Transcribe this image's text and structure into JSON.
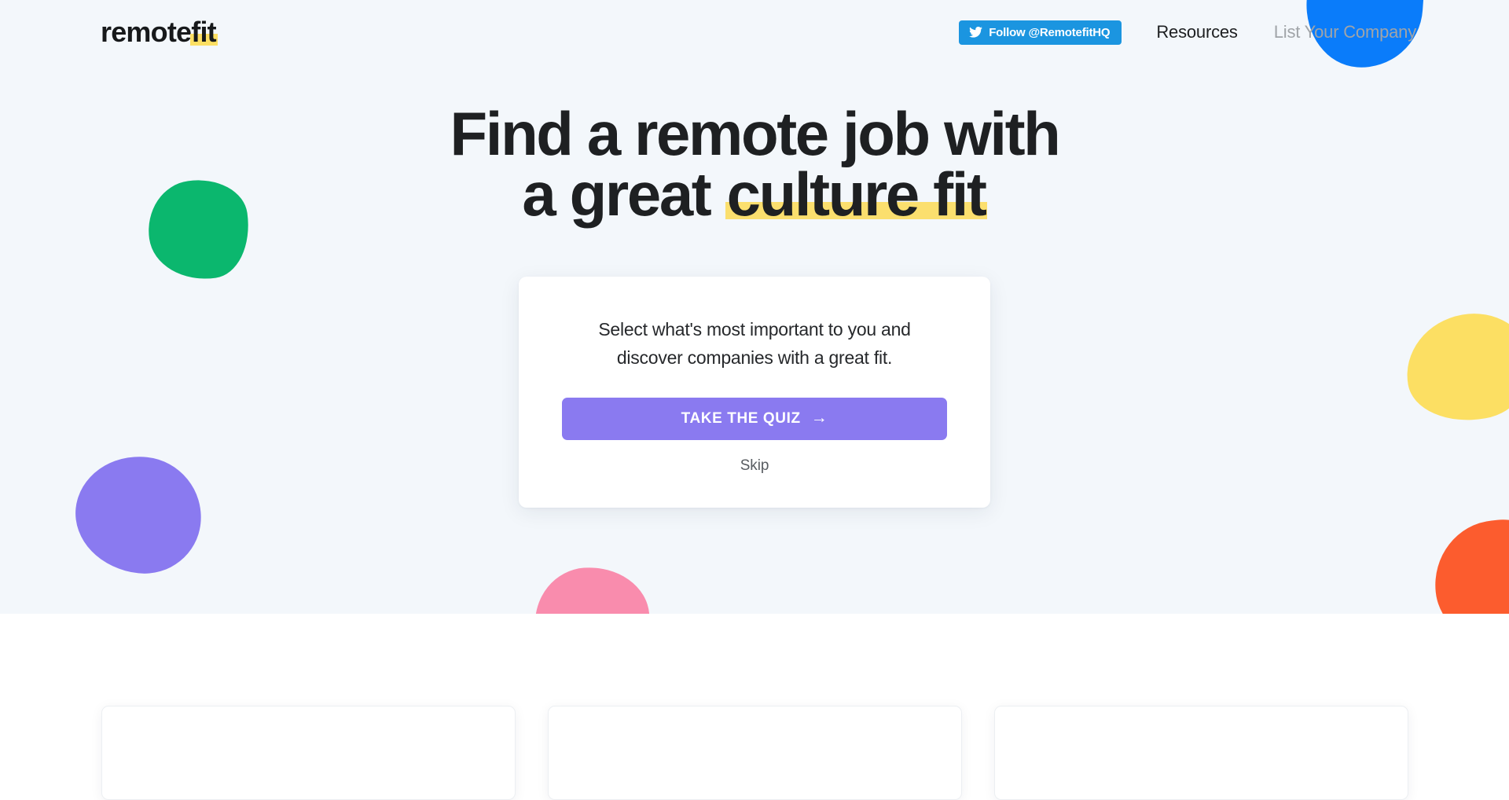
{
  "header": {
    "logo": {
      "text_main": "remote",
      "text_highlight": "fit"
    },
    "twitter_button": {
      "label": "Follow @RemotefitHQ",
      "icon": "twitter-bird-icon",
      "color": "#1b95e0"
    },
    "nav_links": [
      {
        "label": "Resources",
        "style": "dark"
      },
      {
        "label": "List Your Company",
        "style": "muted"
      }
    ]
  },
  "hero": {
    "background_color": "#f3f7fb",
    "headline": {
      "line1": "Find a remote job with",
      "line2_prefix": "a great ",
      "line2_highlight": "culture fit",
      "highlight_color": "#fbdf6e"
    },
    "card": {
      "description_line1": "Select what's most important to you and",
      "description_line2": "discover companies with a great fit.",
      "primary_button": {
        "label": "TAKE THE QUIZ",
        "arrow": "→",
        "color": "#8a7af0"
      },
      "secondary_link": {
        "label": "Skip"
      }
    },
    "blobs": [
      {
        "name": "green-blob",
        "color": "#0bb76e"
      },
      {
        "name": "purple-blob",
        "color": "#8a7af0"
      },
      {
        "name": "blue-blob",
        "color": "#0a7cfa"
      },
      {
        "name": "yellow-blob",
        "color": "#fcdf63"
      },
      {
        "name": "orange-blob",
        "color": "#fc5c2e"
      },
      {
        "name": "pink-blob",
        "color": "#f98cad"
      }
    ]
  },
  "below_section": {
    "cards": [
      {
        "name": "feature-card-1"
      },
      {
        "name": "feature-card-2"
      },
      {
        "name": "feature-card-3"
      }
    ]
  }
}
